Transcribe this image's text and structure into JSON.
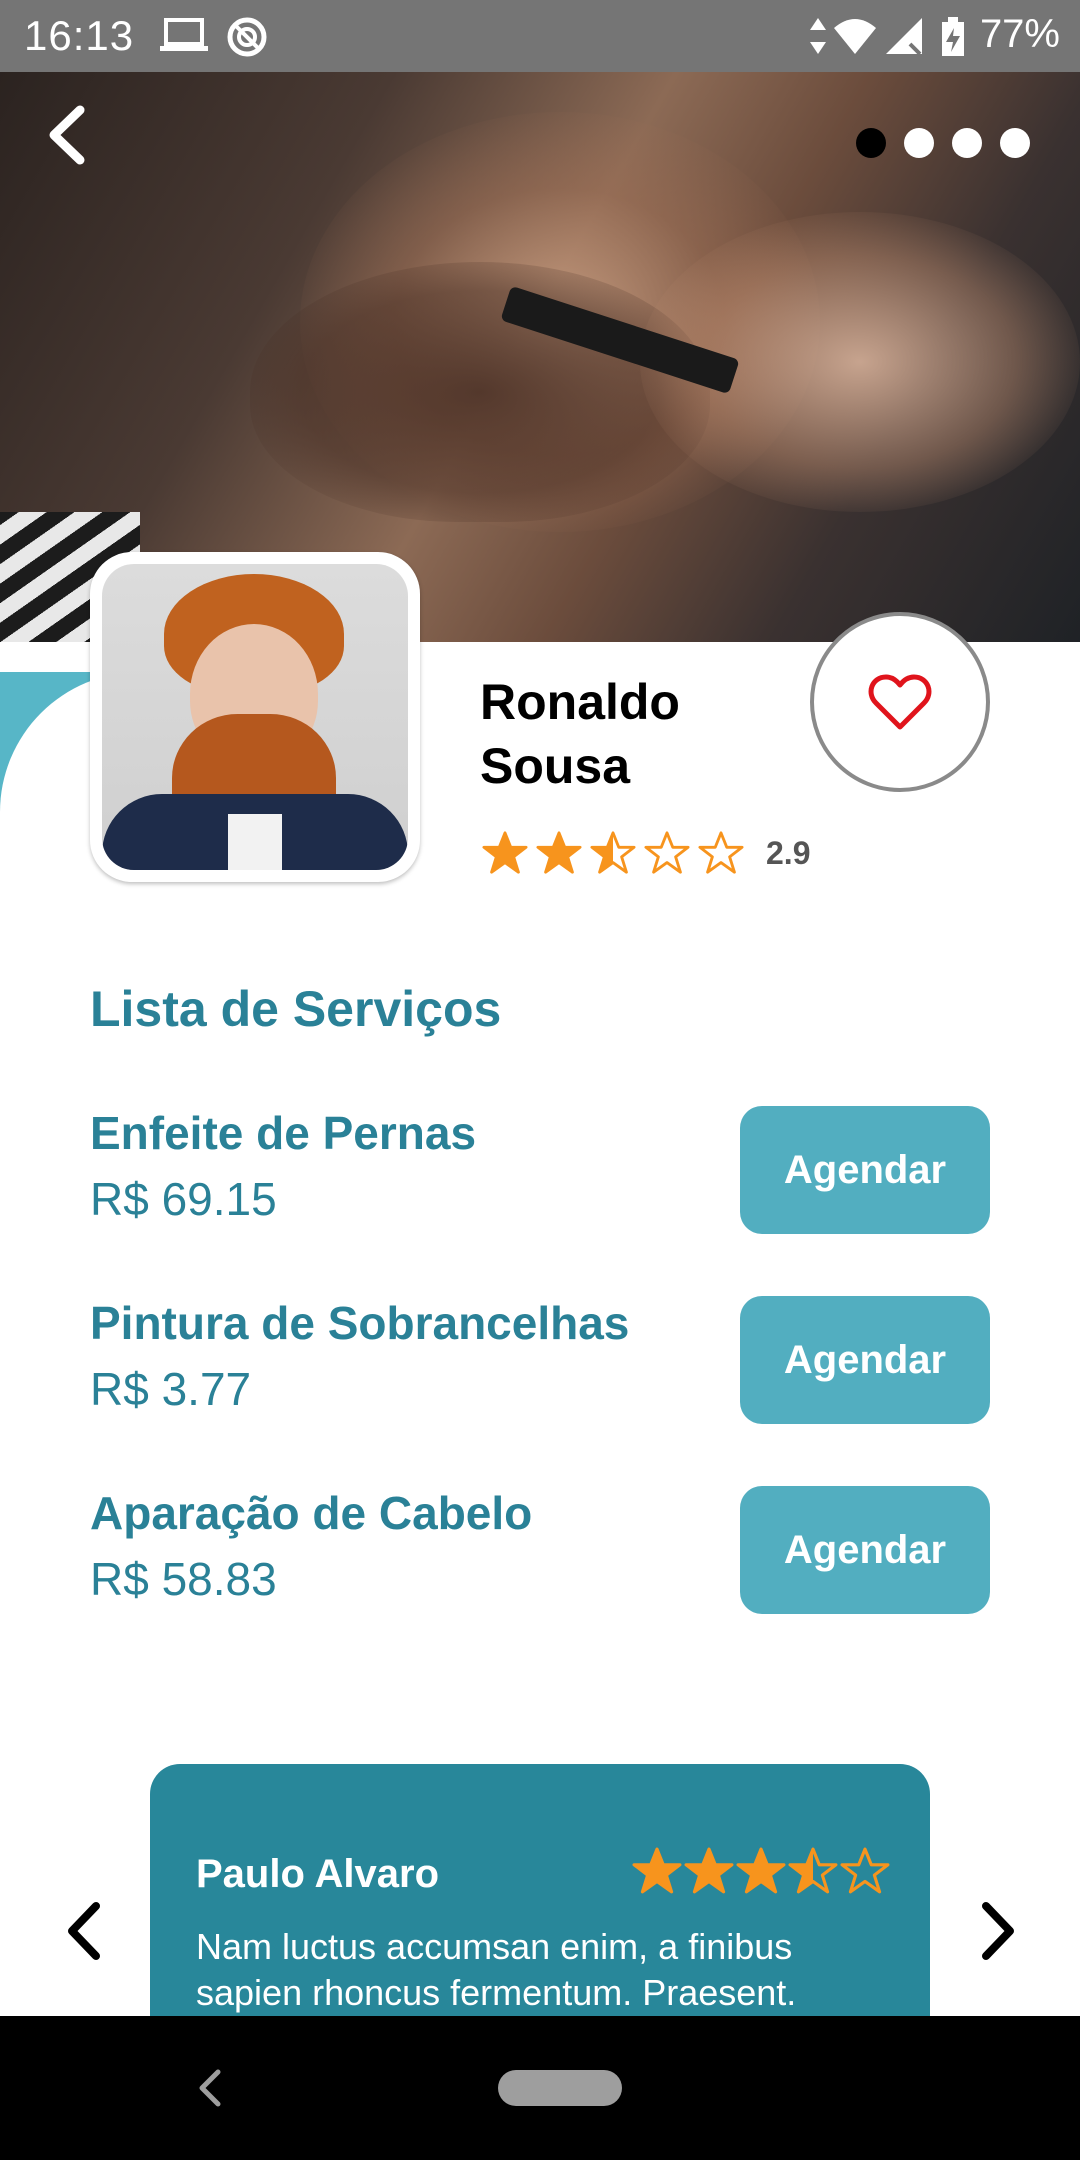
{
  "status_bar": {
    "time": "16:13",
    "battery": "77%"
  },
  "hero": {
    "carousel_active_index": 0,
    "carousel_count": 4
  },
  "profile": {
    "name": "Ronaldo Sousa",
    "rating_value": "2.9",
    "rating": 2.5,
    "max_rating": 5
  },
  "services": {
    "title": "Lista de Serviços",
    "items": [
      {
        "name": "Enfeite de Pernas",
        "price": "R$ 69.15",
        "button": "Agendar"
      },
      {
        "name": "Pintura de Sobrancelhas",
        "price": "R$ 3.77",
        "button": "Agendar"
      },
      {
        "name": "Aparação de Cabelo",
        "price": "R$ 58.83",
        "button": "Agendar"
      }
    ]
  },
  "review": {
    "author": "Paulo Alvaro",
    "rating": 3.5,
    "text": "Nam luctus accumsan enim, a finibus sapien rhoncus fermentum. Praesent."
  },
  "colors": {
    "primary": "#2a8197",
    "button": "#52aec0",
    "card": "#28879a",
    "star": "#f7941d",
    "heart": "#e0141c"
  },
  "icons": {
    "back": "chevron-left-icon",
    "favorite": "heart-outline-icon",
    "review_prev": "chevron-left-icon",
    "review_next": "chevron-right-icon"
  }
}
